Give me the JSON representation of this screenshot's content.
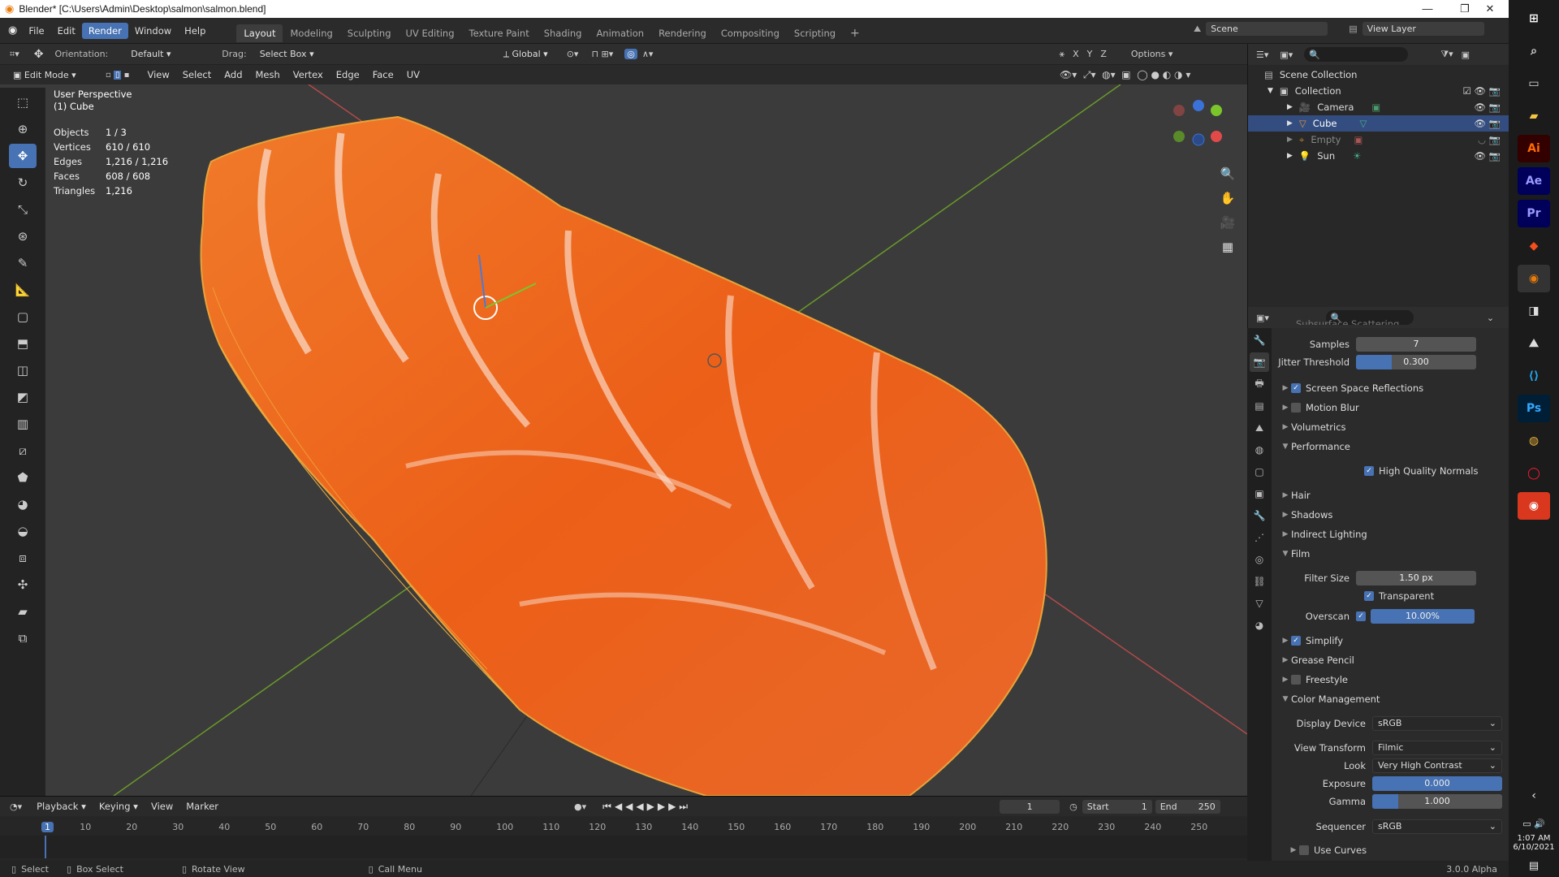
{
  "title": "Blender* [C:\\Users\\Admin\\Desktop\\salmon\\salmon.blend]",
  "menu": [
    "File",
    "Edit",
    "Render",
    "Window",
    "Help"
  ],
  "menu_active": "Render",
  "workspaces": [
    "Layout",
    "Modeling",
    "Sculpting",
    "UV Editing",
    "Texture Paint",
    "Shading",
    "Animation",
    "Rendering",
    "Compositing",
    "Scripting"
  ],
  "workspace_active": "Layout",
  "scene": {
    "label": "Scene",
    "view_layer": "View Layer"
  },
  "header": {
    "orientation_label": "Orientation:",
    "orientation_value": "Default",
    "drag_label": "Drag:",
    "drag_value": "Select Box",
    "transform_orientation": "Global",
    "options": "Options",
    "axes": [
      "X",
      "Y",
      "Z"
    ]
  },
  "mode_bar": {
    "mode": "Edit Mode",
    "items": [
      "View",
      "Select",
      "Add",
      "Mesh",
      "Vertex",
      "Edge",
      "Face",
      "UV"
    ]
  },
  "viewport_info": {
    "perspective": "User Perspective",
    "object": "(1) Cube"
  },
  "stats": [
    {
      "k": "Objects",
      "v": "1 / 3"
    },
    {
      "k": "Vertices",
      "v": "610 / 610"
    },
    {
      "k": "Edges",
      "v": "1,216 / 1,216"
    },
    {
      "k": "Faces",
      "v": "608 / 608"
    },
    {
      "k": "Triangles",
      "v": "1,216"
    }
  ],
  "outliner": {
    "root": "Scene Collection",
    "collection": "Collection",
    "items": [
      {
        "name": "Camera",
        "selected": false
      },
      {
        "name": "Cube",
        "selected": true
      },
      {
        "name": "Empty",
        "selected": false
      },
      {
        "name": "Sun",
        "selected": false
      }
    ]
  },
  "properties": {
    "truncated_header": "Subsurface Scattering",
    "samples_label": "Samples",
    "samples": "7",
    "jitter_label": "Jitter Threshold",
    "jitter": "0.300",
    "jitter_frac": 0.3,
    "ssr": "Screen Space Reflections",
    "motion_blur": "Motion Blur",
    "volumetrics": "Volumetrics",
    "performance": "Performance",
    "hq_normals": "High Quality Normals",
    "hair": "Hair",
    "shadows": "Shadows",
    "indirect": "Indirect Lighting",
    "film": "Film",
    "filter_size_label": "Filter Size",
    "filter_size": "1.50 px",
    "transparent": "Transparent",
    "overscan_label": "Overscan",
    "overscan": "10.00%",
    "overscan_frac": 1.0,
    "simplify": "Simplify",
    "grease_pencil": "Grease Pencil",
    "freestyle": "Freestyle",
    "color_mgmt": "Color Management",
    "display_device_label": "Display Device",
    "display_device": "sRGB",
    "view_transform_label": "View Transform",
    "view_transform": "Filmic",
    "look_label": "Look",
    "look": "Very High Contrast",
    "exposure_label": "Exposure",
    "exposure": "0.000",
    "gamma_label": "Gamma",
    "gamma": "1.000",
    "gamma_frac": 0.2,
    "sequencer_label": "Sequencer",
    "sequencer": "sRGB",
    "use_curves": "Use Curves"
  },
  "timeline": {
    "menus": [
      "Playback",
      "Keying",
      "View",
      "Marker"
    ],
    "current": "1",
    "start_label": "Start",
    "start": "1",
    "end_label": "End",
    "end": "250",
    "ticks": [
      "1",
      "10",
      "20",
      "30",
      "40",
      "50",
      "60",
      "70",
      "80",
      "90",
      "100",
      "110",
      "120",
      "130",
      "140",
      "150",
      "160",
      "170",
      "180",
      "190",
      "200",
      "210",
      "220",
      "230",
      "240",
      "250"
    ]
  },
  "status": {
    "select": "Select",
    "box_select": "Box Select",
    "rotate": "Rotate View",
    "call_menu": "Call Menu",
    "version": "3.0.0 Alpha"
  },
  "clock": {
    "time": "1:07 AM",
    "date": "6/10/2021"
  },
  "taskbar_apps": [
    {
      "name": "Ai",
      "color": "#ff6a00"
    },
    {
      "name": "Ae",
      "color": "#9999ff"
    },
    {
      "name": "Pr",
      "color": "#9999ff"
    },
    {
      "name": "Ps",
      "color": "#31a8ff"
    }
  ],
  "colors": {
    "accent": "#4772b3",
    "salmon": "#f06a1e",
    "selected_row": "#334d80"
  }
}
